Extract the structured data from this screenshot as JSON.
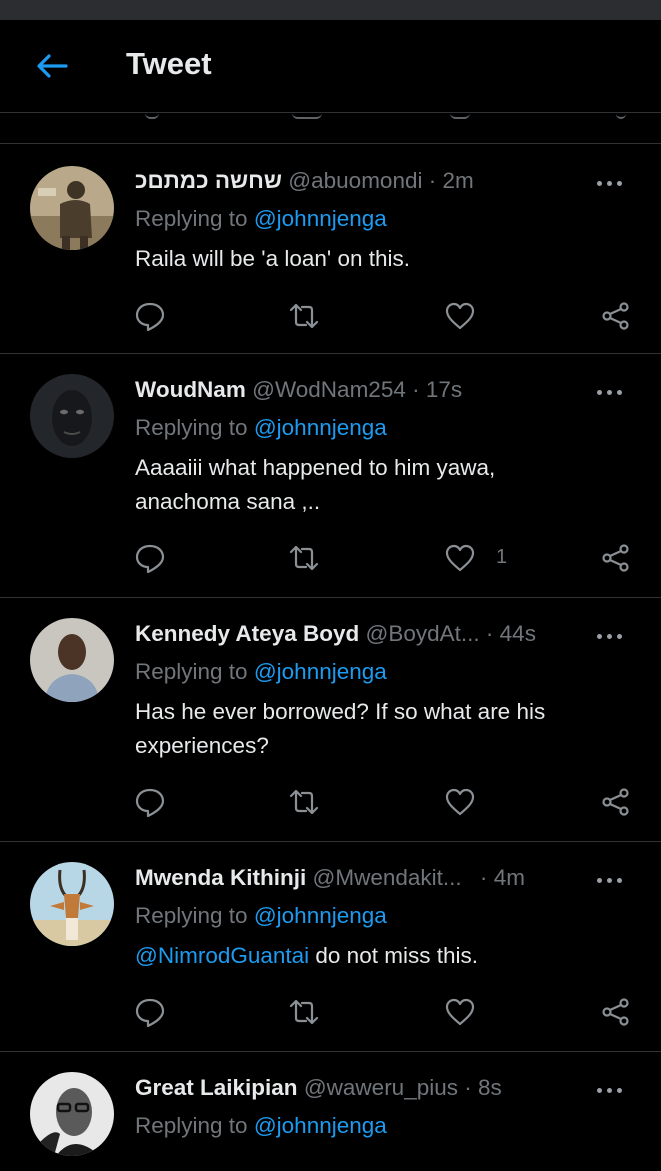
{
  "header": {
    "title": "Tweet",
    "back_icon": "arrow-left-icon",
    "accent": "#1d9bf0"
  },
  "colors": {
    "background": "#000000",
    "text": "#e7e9ea",
    "muted": "#71767b",
    "divider": "#2f3336",
    "link": "#1d9bf0"
  },
  "tweets": [
    {
      "name": "שחשה כמתםכ",
      "handle": "@abuomondi",
      "sep": "·",
      "time": "2m",
      "reply_prefix": "Replying to ",
      "reply_to": "@johnnjenga",
      "text_lines": [
        "Raila will be 'a loan' on this."
      ],
      "like_count": ""
    },
    {
      "name": "WoudNam",
      "handle": "@WodNam254",
      "sep": "·",
      "time": "17s",
      "reply_prefix": "Replying to ",
      "reply_to": "@johnnjenga",
      "text_lines": [
        "Aaaaiii what happened to him yawa,",
        "anachoma sana ,.."
      ],
      "like_count": "1"
    },
    {
      "name": "Kennedy Ateya Boyd",
      "handle": "@BoydAt...",
      "sep": "·",
      "time": "44s",
      "reply_prefix": "Replying to ",
      "reply_to": "@johnnjenga",
      "text_lines": [
        "Has he ever borrowed? If so what are his",
        "experiences?"
      ],
      "like_count": ""
    },
    {
      "name": "Mwenda Kithinji",
      "handle": "@Mwendakit...",
      "sep": "·",
      "time": "4m",
      "reply_prefix": "Replying to ",
      "reply_to": "@johnnjenga",
      "text_mention": "@NimrodGuantai",
      "text_rest": " do not miss this.",
      "like_count": ""
    },
    {
      "name": "Great Laikipian",
      "handle": "@waweru_pius",
      "sep": "·",
      "time": "8s",
      "reply_prefix": "Replying to ",
      "reply_to": "@johnnjenga"
    }
  ]
}
